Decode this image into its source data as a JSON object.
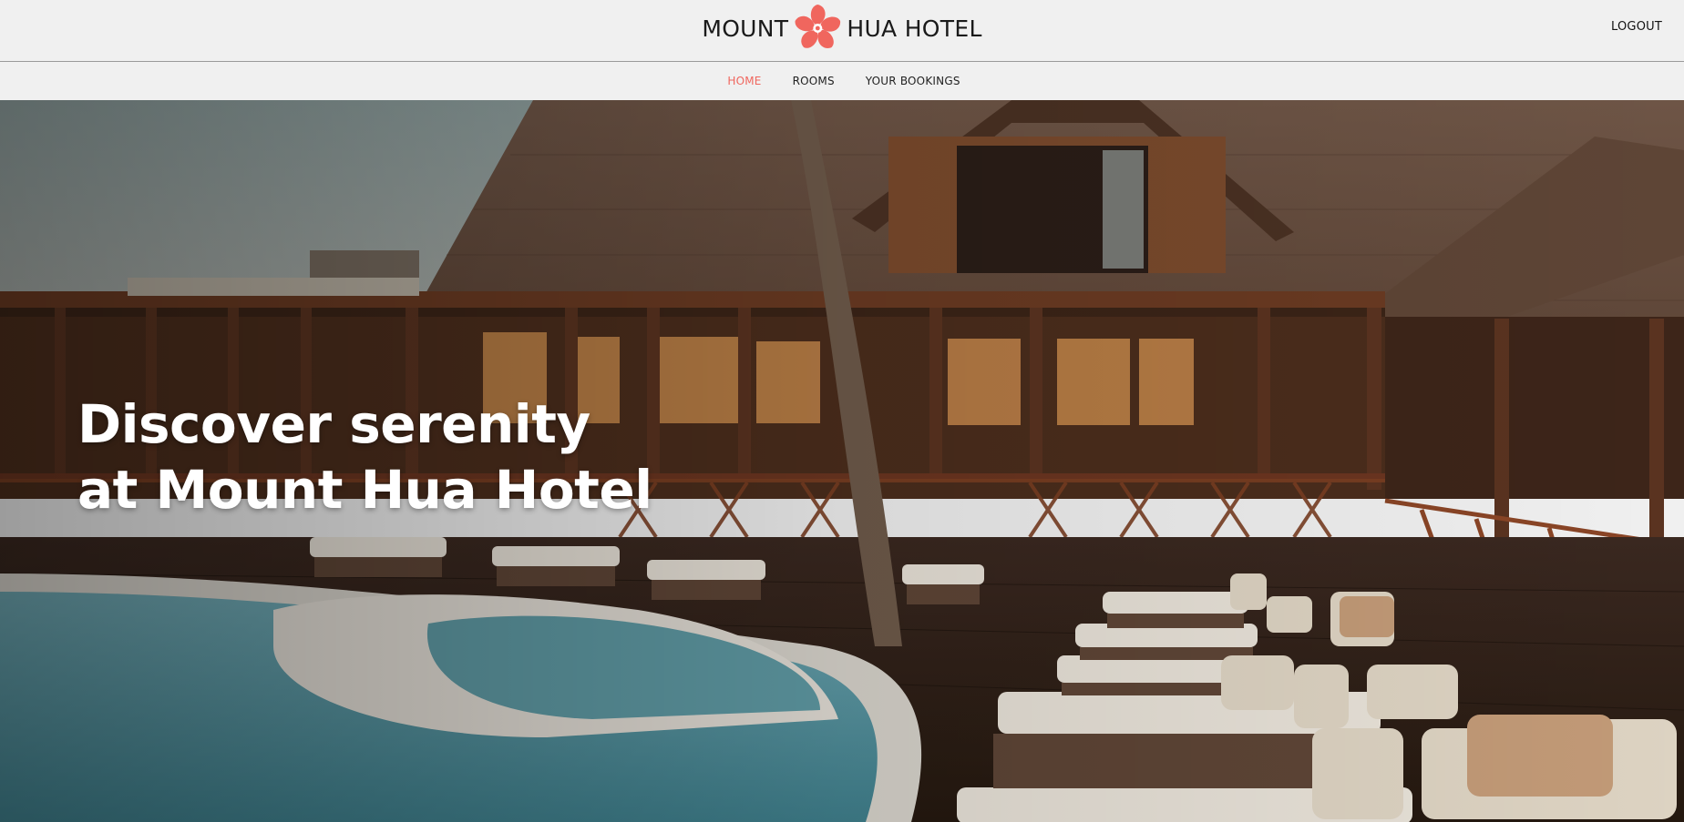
{
  "header": {
    "brand_left": "MOUNT",
    "brand_right": "HUA HOTEL",
    "logo_icon": "plum-blossom-icon",
    "logout_label": "LOGOUT"
  },
  "nav": {
    "items": [
      {
        "label": "HOME",
        "active": true
      },
      {
        "label": "ROOMS",
        "active": false
      },
      {
        "label": "YOUR BOOKINGS",
        "active": false
      }
    ]
  },
  "hero": {
    "line1": "Discover serenity",
    "line2": "at Mount Hua Hotel"
  },
  "colors": {
    "accent": "#f0665e",
    "background": "#f0f0f0",
    "text": "#111111"
  }
}
